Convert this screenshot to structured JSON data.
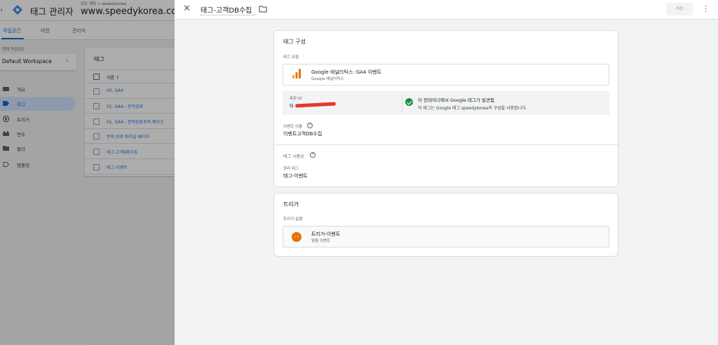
{
  "app": {
    "title": "태그 관리자",
    "breadcrumb": "모든 계정 > speedykorea",
    "container_name": "www.speedykorea.com/"
  },
  "nav_tabs": [
    {
      "label": "작업공간",
      "active": true
    },
    {
      "label": "버전",
      "active": false
    },
    {
      "label": "관리자",
      "active": false
    }
  ],
  "workspace": {
    "label": "현재 작업공간",
    "value": "Default Workspace"
  },
  "sidebar": {
    "items": [
      {
        "label": "개요",
        "icon": "overview-icon",
        "active": false
      },
      {
        "label": "태그",
        "icon": "tag-icon",
        "active": true
      },
      {
        "label": "트리거",
        "icon": "trigger-icon",
        "active": false
      },
      {
        "label": "변수",
        "icon": "variable-icon",
        "active": false
      },
      {
        "label": "폴더",
        "icon": "folder-icon",
        "active": false
      },
      {
        "label": "템플릿",
        "icon": "template-icon",
        "active": false
      }
    ]
  },
  "tags_list": {
    "title": "태그",
    "column_header": "이름 ↑",
    "rows": [
      "00. GA4",
      "01. GA4 - 문의완료",
      "01. GA4 - 문의완료추적 베이스",
      "문의 완료 파이널 페이지",
      "태그-고객DB수집",
      "태그-이벤트"
    ]
  },
  "panel": {
    "title": "태그-고객DB수집",
    "save_label": "저장",
    "tag_config": {
      "title": "태그 구성",
      "type_label": "태그 유형",
      "type_name": "Google 애널리틱스: GA4 이벤트",
      "type_sub": "Google 애널리틱스",
      "measurement_label": "측정 ID",
      "measurement_value_prefix": "G",
      "status_title": "이 컨테이너에서 Google 태그가 발견됨",
      "status_desc": "이 태그는 Google 태그 speedykorea의 구성을 사용합니다.",
      "event_name_label": "이벤트 이름",
      "event_name_value": "이벤트고객DB수집",
      "sequencing_label": "태그 시퀀싱",
      "setup_tag_label": "정리 태그",
      "setup_tag_value": "태그-이벤트"
    },
    "triggering": {
      "title": "트리거",
      "firing_label": "트리거 실행",
      "trigger_name": "트리거-이벤트",
      "trigger_type": "맞춤 이벤트"
    }
  },
  "colors": {
    "accent": "#1a73e8",
    "active_nav_bg": "#d2e3fc",
    "success": "#1e8e3e",
    "trigger_icon": "#e8710a",
    "redaction": "#e8372c"
  }
}
